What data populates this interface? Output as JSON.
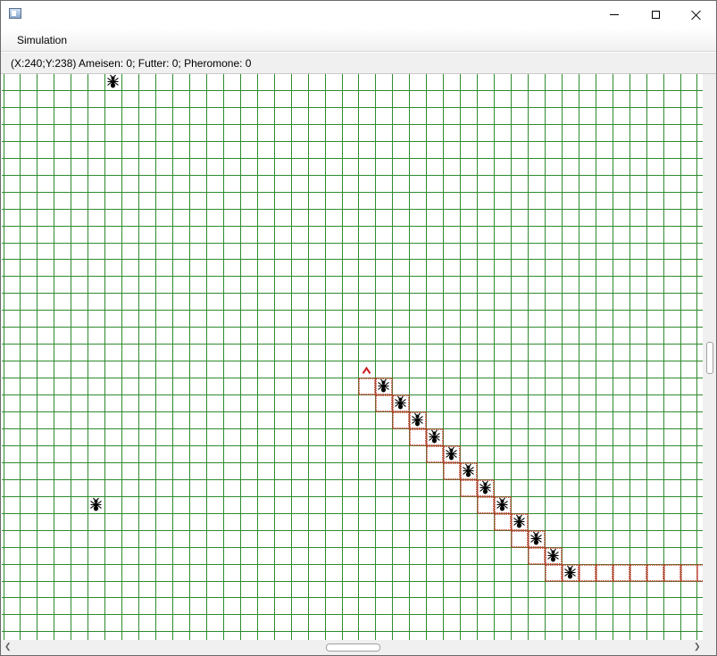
{
  "window": {
    "icon": "app-window-icon",
    "controls": [
      "minimize-icon",
      "maximize-icon",
      "close-icon"
    ]
  },
  "menu": {
    "items": [
      {
        "label": "Simulation"
      }
    ]
  },
  "status": {
    "text": "(X:240;Y:238) Ameisen: 0; Futter: 0; Pheromone: 0"
  },
  "grid": {
    "line_color": "#2e8b2e",
    "ant_icon": "ant-icon",
    "ants": [
      {
        "col": 6,
        "row": 0
      },
      {
        "col": 5,
        "row": 25
      }
    ],
    "anthill": {
      "col": 21,
      "row": 17,
      "icon": "anthill-icon",
      "color": "#cc1b1b"
    },
    "trail_color": "#c0392b",
    "trail": [
      {
        "col": 21,
        "row": 18,
        "ant": false
      },
      {
        "col": 22,
        "row": 18,
        "ant": true
      },
      {
        "col": 22,
        "row": 19,
        "ant": false
      },
      {
        "col": 23,
        "row": 19,
        "ant": true
      },
      {
        "col": 23,
        "row": 20,
        "ant": false
      },
      {
        "col": 24,
        "row": 20,
        "ant": true
      },
      {
        "col": 24,
        "row": 21,
        "ant": false
      },
      {
        "col": 25,
        "row": 21,
        "ant": true
      },
      {
        "col": 25,
        "row": 22,
        "ant": false
      },
      {
        "col": 26,
        "row": 22,
        "ant": true
      },
      {
        "col": 26,
        "row": 23,
        "ant": false
      },
      {
        "col": 27,
        "row": 23,
        "ant": true
      },
      {
        "col": 27,
        "row": 24,
        "ant": false
      },
      {
        "col": 28,
        "row": 24,
        "ant": true
      },
      {
        "col": 28,
        "row": 25,
        "ant": false
      },
      {
        "col": 29,
        "row": 25,
        "ant": true
      },
      {
        "col": 29,
        "row": 26,
        "ant": false
      },
      {
        "col": 30,
        "row": 26,
        "ant": true
      },
      {
        "col": 30,
        "row": 27,
        "ant": false
      },
      {
        "col": 31,
        "row": 27,
        "ant": true
      },
      {
        "col": 31,
        "row": 28,
        "ant": false
      },
      {
        "col": 32,
        "row": 28,
        "ant": true
      },
      {
        "col": 32,
        "row": 29,
        "ant": false
      },
      {
        "col": 33,
        "row": 29,
        "ant": true
      },
      {
        "col": 34,
        "row": 29,
        "ant": false
      },
      {
        "col": 35,
        "row": 29,
        "ant": false
      },
      {
        "col": 36,
        "row": 29,
        "ant": false
      },
      {
        "col": 37,
        "row": 29,
        "ant": false
      },
      {
        "col": 38,
        "row": 29,
        "ant": false
      },
      {
        "col": 39,
        "row": 29,
        "ant": false
      },
      {
        "col": 40,
        "row": 29,
        "ant": false
      },
      {
        "col": 41,
        "row": 29,
        "ant": false
      }
    ]
  },
  "scrollbars": {
    "icons": [
      "scroll-left-icon",
      "scroll-right-icon"
    ]
  }
}
